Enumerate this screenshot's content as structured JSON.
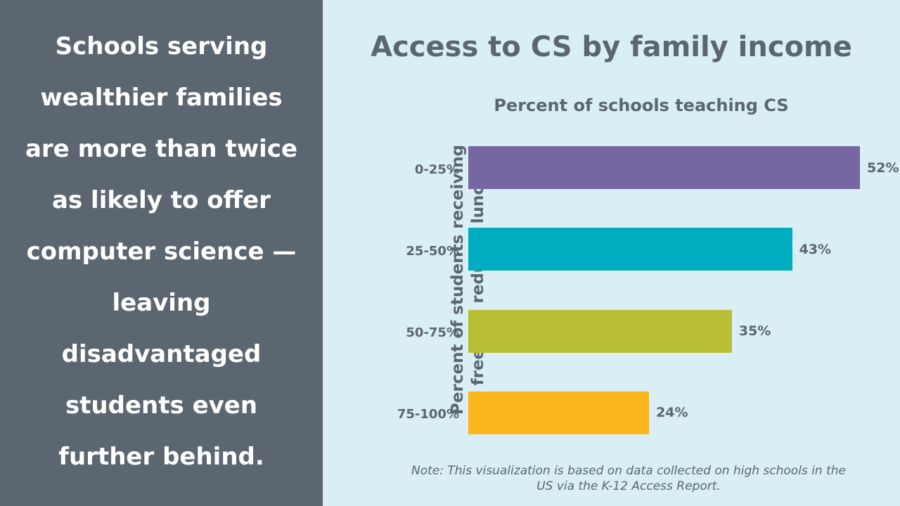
{
  "statement": {
    "lines": [
      "Schools serving",
      "wealthier families",
      "are more than twice",
      "as likely to offer",
      "computer science —",
      "leaving",
      "disadvantaged",
      "students even",
      "further behind."
    ]
  },
  "note": {
    "lines": [
      "Note: This visualization is based on data collected on high schools in the",
      "US via the K-12 Access Report."
    ]
  },
  "colors": {
    "left_panel": "#5b6670",
    "background": "#daeef6",
    "text": "#5b6670"
  },
  "chart_data": {
    "type": "bar",
    "orientation": "horizontal",
    "title": "Access to CS by family income",
    "subtitle": "Percent of schools teaching CS",
    "ylabel": [
      "Percent of students receiving",
      "free and reduced lunch"
    ],
    "xlabel": "",
    "categories": [
      "0-25%",
      "25-50%",
      "50-75%",
      "75-100%"
    ],
    "values": [
      52,
      43,
      35,
      24
    ],
    "value_labels": [
      "52%",
      "43%",
      "35%",
      "24%"
    ],
    "colors": [
      "#7667a2",
      "#00adc0",
      "#b8bf35",
      "#fbb61e"
    ],
    "xlim": [
      0,
      52
    ],
    "grid": false,
    "legend": "none"
  }
}
